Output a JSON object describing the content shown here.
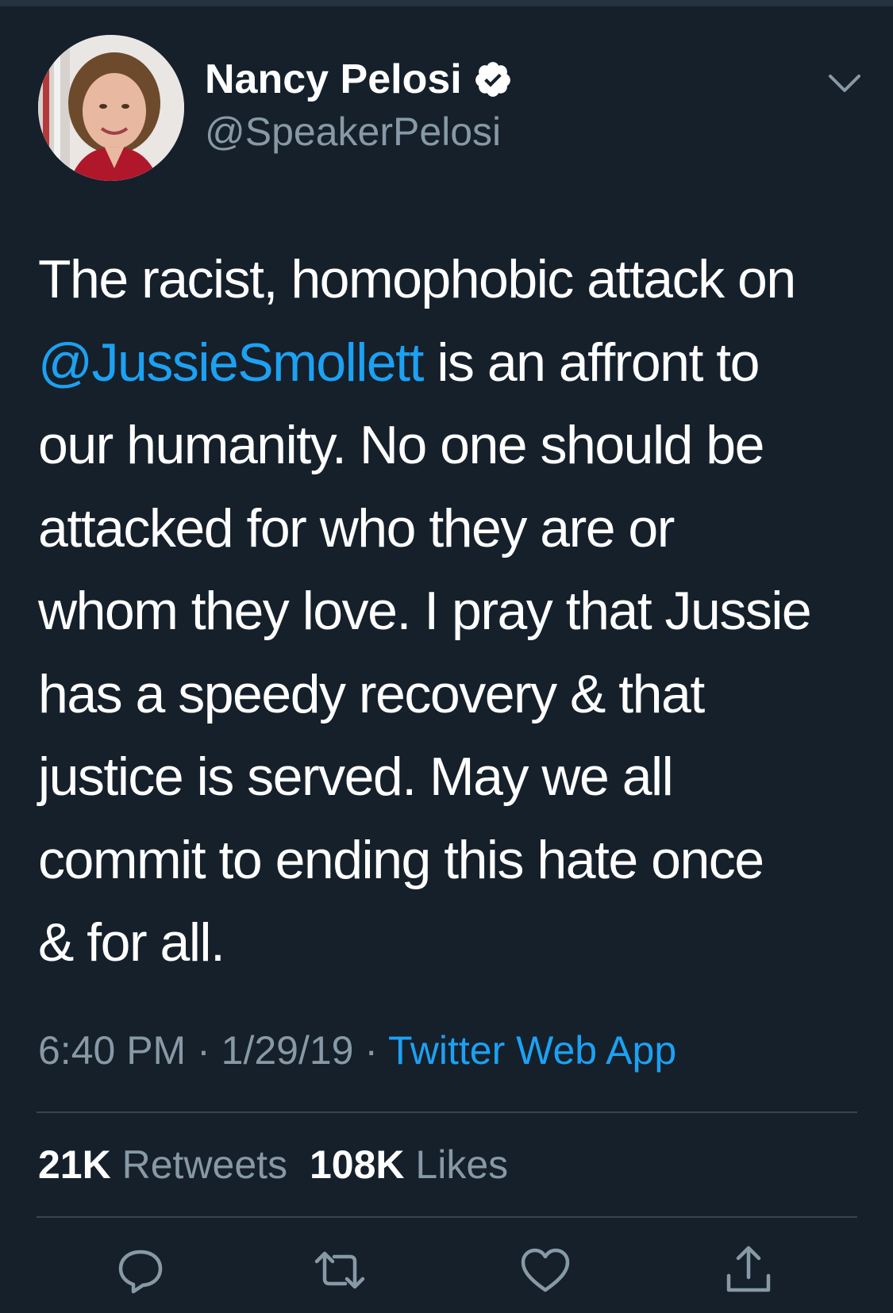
{
  "user": {
    "name": "Nancy Pelosi",
    "handle": "@SpeakerPelosi",
    "verified": true
  },
  "tweet": {
    "lines": [
      {
        "before": "The racist, homophobic attack on",
        "mention": "",
        "after": ""
      },
      {
        "before": "",
        "mention": "@JussieSmollett",
        "after": " is an affront to"
      },
      {
        "before": "our humanity. No one should be",
        "mention": "",
        "after": ""
      },
      {
        "before": "attacked for who they are or",
        "mention": "",
        "after": ""
      },
      {
        "before": "whom they love. I pray that Jussie",
        "mention": "",
        "after": ""
      },
      {
        "before": "has a speedy recovery & that",
        "mention": "",
        "after": ""
      },
      {
        "before": "justice is served. May we all",
        "mention": "",
        "after": ""
      },
      {
        "before": "commit to ending this hate once",
        "mention": "",
        "after": ""
      },
      {
        "before": "& for all.",
        "mention": "",
        "after": ""
      }
    ]
  },
  "meta": {
    "time": "6:40 PM",
    "separator": " · ",
    "date": "1/29/19",
    "source": "Twitter Web App"
  },
  "stats": {
    "retweets_count": "21K",
    "retweets_label": "Retweets",
    "likes_count": "108K",
    "likes_label": "Likes"
  },
  "icons": {
    "reply": "reply-icon",
    "retweet": "retweet-icon",
    "like": "heart-icon",
    "share": "share-icon",
    "more": "chevron-down-icon",
    "verified": "verified-badge-icon"
  },
  "colors": {
    "background": "#15202b",
    "link": "#1da1f2",
    "secondary_text": "#8899a6",
    "divider": "#38444d"
  }
}
